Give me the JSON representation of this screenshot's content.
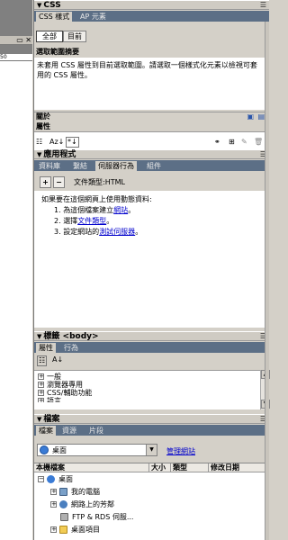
{
  "left": {
    "ruler_text": "50"
  },
  "css_panel": {
    "title": "CSS",
    "tabs": [
      "CSS 樣式",
      "AP 元素"
    ],
    "mode_buttons": [
      "全部",
      "目前"
    ],
    "summary_heading": "選取範圍摘要",
    "summary_text": "未套用 CSS 屬性到目前選取範圍。請選取一個樣式化元素以檢視可套用的 CSS 屬性。",
    "rules_label": "關於",
    "props_label": "屬性"
  },
  "app_panel": {
    "title": "應用程式",
    "tabs": [
      "資料庫",
      "繫結",
      "伺服器行為",
      "組件"
    ],
    "doctype": "文件類型:HTML",
    "intro": "如果要在這個網頁上使用動態資料:",
    "steps": [
      {
        "num": "1.",
        "before": "為這個檔案建立",
        "link": "網站",
        "after": "。"
      },
      {
        "num": "2.",
        "before": "選擇",
        "link": "文件類型",
        "after": "。"
      },
      {
        "num": "3.",
        "before": "設定網站的",
        "link": "測試伺服器",
        "after": "。"
      }
    ]
  },
  "tag_panel": {
    "title": "標籤 <body>",
    "tabs": [
      "屬性",
      "行為"
    ],
    "categories": [
      "一般",
      "瀏覽器專用",
      "CSS/輔助功能",
      "語言"
    ]
  },
  "files_panel": {
    "title": "檔案",
    "tabs": [
      "檔案",
      "資源",
      "片段"
    ],
    "location": "桌面",
    "manage_link": "管理網站",
    "columns": [
      "本機檔案",
      "大小",
      "類型",
      "修改日期"
    ],
    "tree": [
      {
        "label": "桌面",
        "icon": "desktop-icon",
        "expander": "−",
        "indent": 0
      },
      {
        "label": "我的電腦",
        "icon": "computer-icon",
        "expander": "+",
        "indent": 1
      },
      {
        "label": "網路上的芳鄰",
        "icon": "network-icon",
        "expander": "+",
        "indent": 1
      },
      {
        "label": "FTP & RDS 伺服...",
        "icon": "server-icon",
        "expander": "",
        "indent": 1
      },
      {
        "label": "桌面項目",
        "icon": "folder-icon",
        "expander": "+",
        "indent": 1
      }
    ]
  },
  "colors": {
    "tab_bar": "#5c6f86",
    "link": "#0000cc",
    "panel": "#d4d0c8"
  }
}
